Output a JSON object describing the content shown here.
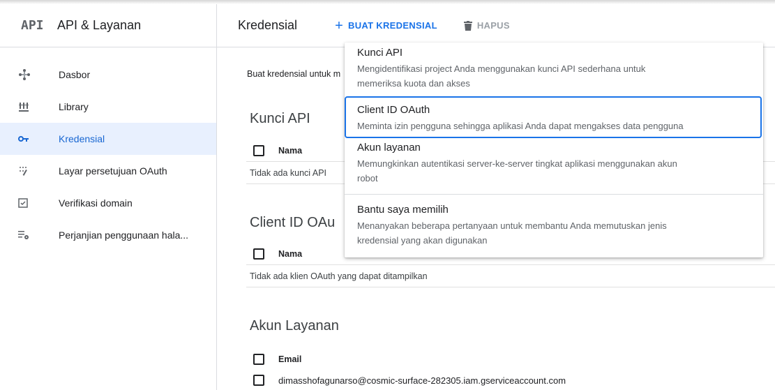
{
  "sidebar": {
    "logo": "API",
    "title": "API & Layanan",
    "items": [
      {
        "label": "Dasbor"
      },
      {
        "label": "Library"
      },
      {
        "label": "Kredensial"
      },
      {
        "label": "Layar persetujuan OAuth"
      },
      {
        "label": "Verifikasi domain"
      },
      {
        "label": "Perjanjian penggunaan hala..."
      }
    ]
  },
  "header": {
    "title": "Kredensial",
    "create_label": "BUAT KREDENSIAL",
    "delete_label": "HAPUS"
  },
  "main": {
    "intro": "Buat kredensial untuk m",
    "api_keys": {
      "title": "Kunci API",
      "col_name": "Nama",
      "empty": "Tidak ada kunci API"
    },
    "oauth": {
      "title": "Client ID OAu",
      "col_name": "Nama",
      "empty": "Tidak ada klien OAuth yang dapat ditampilkan"
    },
    "service": {
      "title": "Akun Layanan",
      "col_email": "Email",
      "rows": [
        {
          "email": "dimasshofagunarso@cosmic-surface-282305.iam.gserviceaccount.com"
        }
      ]
    }
  },
  "menu": {
    "items": [
      {
        "title": "Kunci API",
        "desc1": "Mengidentifikasi project Anda menggunakan kunci API sederhana untuk",
        "desc2": "memeriksa kuota dan akses"
      },
      {
        "title": "Client ID OAuth",
        "desc1": "Meminta izin pengguna sehingga aplikasi Anda dapat mengakses data pengguna"
      },
      {
        "title": "Akun layanan",
        "desc1": "Memungkinkan autentikasi server-ke-server tingkat aplikasi menggunakan akun",
        "desc2": "robot"
      },
      {
        "title": "Bantu saya memilih",
        "desc1": "Menanyakan beberapa pertanyaan untuk membantu Anda memutuskan jenis",
        "desc2": "kredensial yang akan digunakan"
      }
    ]
  },
  "colors": {
    "accent": "#1a73e8",
    "active_bg": "#e8f0fe",
    "active_text": "#1967d2"
  }
}
